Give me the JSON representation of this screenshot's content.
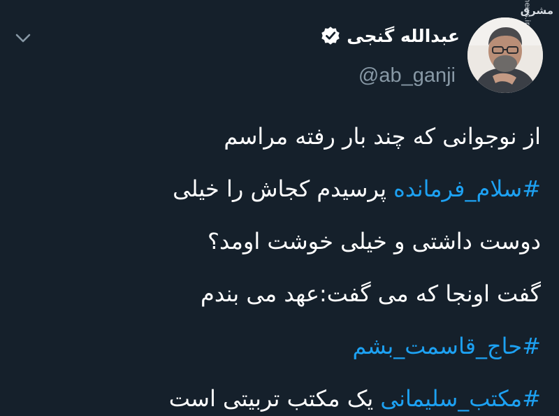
{
  "tweet": {
    "author": {
      "display_name": "عبدالله گنجی",
      "handle": "@ab_ganji",
      "verified": true
    },
    "menu_icon": "chevron-down-icon",
    "lines": [
      {
        "text": "از نوجوانی که چند بار رفته مراسم"
      },
      {
        "hashtag": "#سلام_فرمانده",
        "text": "  پرسیدم کجاش را خیلی"
      },
      {
        "text": "دوست داشتی و خیلی خوشت اومد؟"
      },
      {
        "text": "گفت اونجا که می گفت:عهد می بندم"
      },
      {
        "hashtag": "#حاج_قاسمت_بشم"
      },
      {
        "hashtag": "#مکتب_سلیمانی",
        "text": " یک مکتب تربیتی است"
      }
    ]
  },
  "watermark": {
    "logo": "مشرق",
    "site": "mashreghnews.ir"
  },
  "colors": {
    "background": "#15202b",
    "text": "#ffffff",
    "muted": "#8899a6",
    "link": "#1da1f2",
    "verified_badge": "#ffffff"
  }
}
